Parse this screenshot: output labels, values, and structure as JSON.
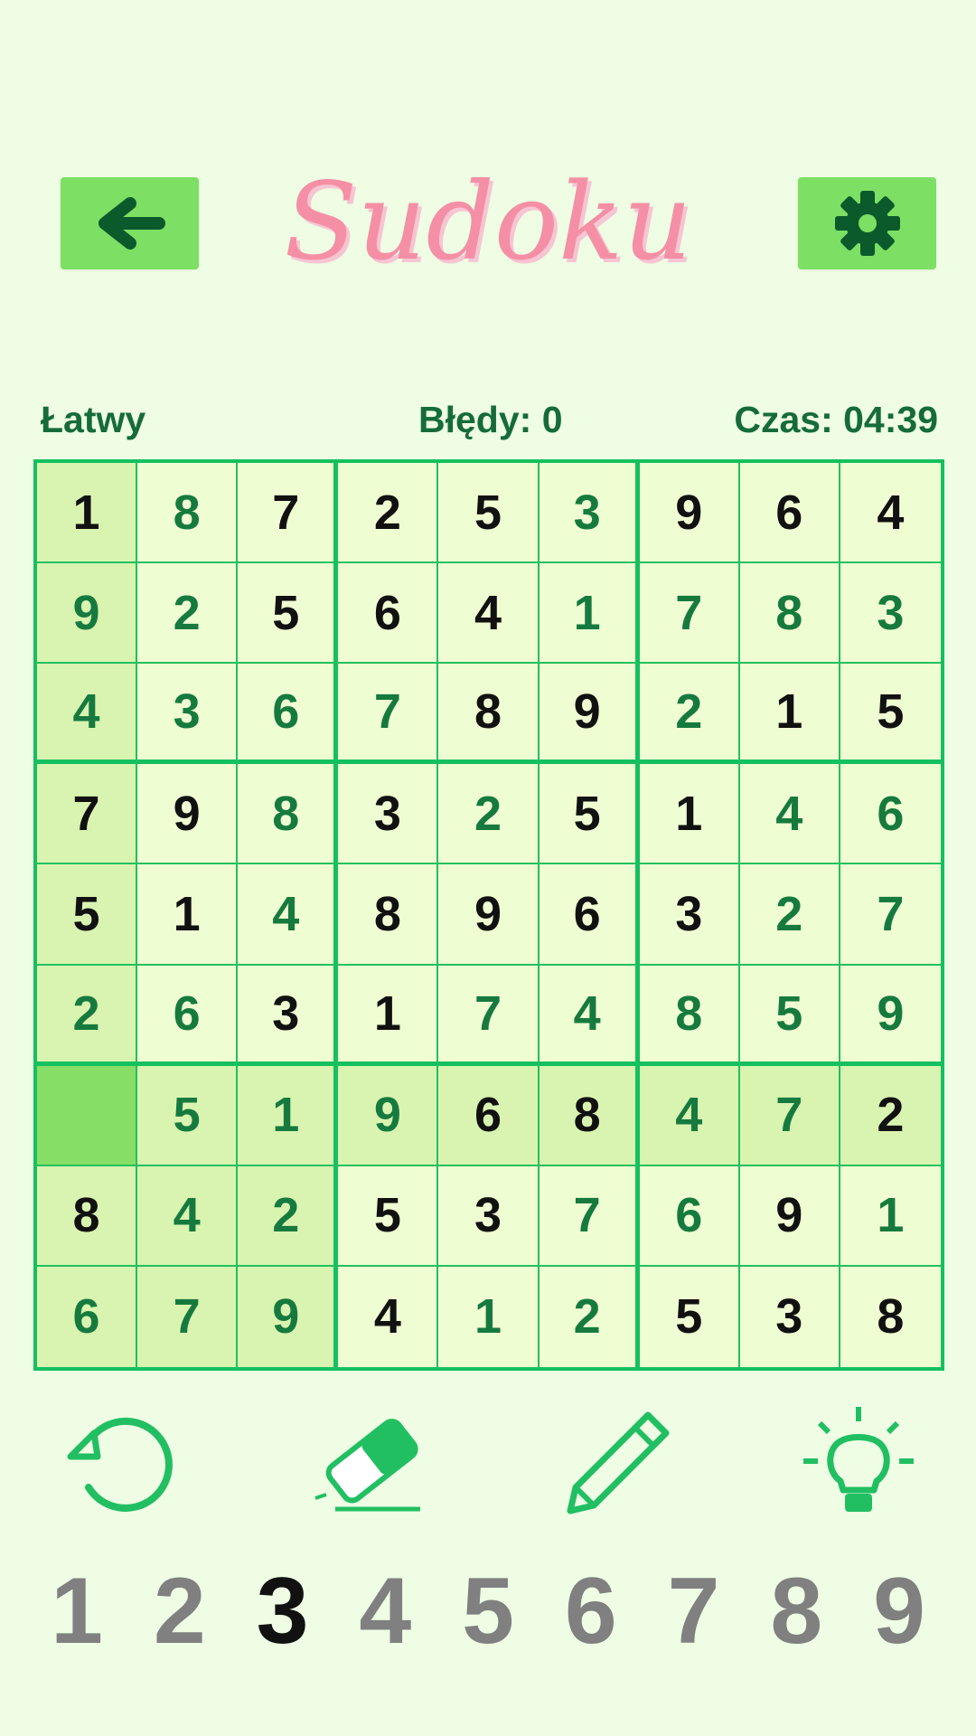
{
  "header": {
    "title": "Sudoku",
    "back_icon": "arrow-left-icon",
    "settings_icon": "gear-icon"
  },
  "status": {
    "difficulty": "Łatwy",
    "mistakes": "Błędy: 0",
    "time": "Czas: 04:39"
  },
  "board": {
    "rows": [
      [
        "1",
        "8",
        "7",
        "2",
        "5",
        "3",
        "9",
        "6",
        "4"
      ],
      [
        "9",
        "2",
        "5",
        "6",
        "4",
        "1",
        "7",
        "8",
        "3"
      ],
      [
        "4",
        "3",
        "6",
        "7",
        "8",
        "9",
        "2",
        "1",
        "5"
      ],
      [
        "7",
        "9",
        "8",
        "3",
        "2",
        "5",
        "1",
        "4",
        "6"
      ],
      [
        "5",
        "1",
        "4",
        "8",
        "9",
        "6",
        "3",
        "2",
        "7"
      ],
      [
        "2",
        "6",
        "3",
        "1",
        "7",
        "4",
        "8",
        "5",
        "9"
      ],
      [
        "",
        "5",
        "1",
        "9",
        "6",
        "8",
        "4",
        "7",
        "2"
      ],
      [
        "8",
        "4",
        "2",
        "5",
        "3",
        "7",
        "6",
        "9",
        "1"
      ],
      [
        "6",
        "7",
        "9",
        "4",
        "1",
        "2",
        "5",
        "3",
        "8"
      ]
    ],
    "user_filled": [
      [
        0,
        1,
        0,
        0,
        0,
        1,
        0,
        0,
        0
      ],
      [
        1,
        1,
        0,
        0,
        0,
        1,
        1,
        1,
        1
      ],
      [
        1,
        1,
        1,
        1,
        0,
        0,
        1,
        0,
        0
      ],
      [
        0,
        0,
        1,
        0,
        1,
        0,
        0,
        1,
        1
      ],
      [
        0,
        0,
        1,
        0,
        0,
        0,
        0,
        1,
        1
      ],
      [
        1,
        1,
        0,
        0,
        1,
        1,
        1,
        1,
        1
      ],
      [
        0,
        1,
        1,
        1,
        0,
        0,
        1,
        1,
        0
      ],
      [
        0,
        1,
        1,
        0,
        0,
        1,
        1,
        0,
        1
      ],
      [
        1,
        1,
        1,
        0,
        1,
        1,
        0,
        0,
        0
      ]
    ],
    "selected": {
      "row": 6,
      "col": 0
    },
    "colors": {
      "given": "#111111",
      "user": "#167a3f",
      "highlight": "#d9f4b0",
      "selected": "#86de66",
      "border": "#14c05f"
    }
  },
  "tools": {
    "undo_icon": "undo-icon",
    "erase_icon": "eraser-icon",
    "pencil_icon": "pencil-icon",
    "hint_icon": "lightbulb-icon"
  },
  "numpad": {
    "numbers": [
      "1",
      "2",
      "3",
      "4",
      "5",
      "6",
      "7",
      "8",
      "9"
    ],
    "active": "3"
  }
}
